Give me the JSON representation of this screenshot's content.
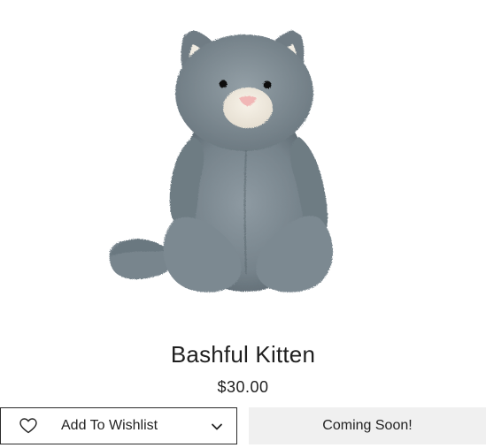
{
  "product": {
    "title": "Bashful Kitten",
    "price": "$30.00"
  },
  "actions": {
    "wishlist_label": "Add To Wishlist",
    "coming_soon_label": "Coming Soon!"
  },
  "icons": {
    "wishlist": "heart-icon",
    "dropdown": "chevron-down-icon"
  },
  "colors": {
    "plush_gray": "#7e8b93",
    "button_border": "#2a2a2a",
    "disabled_bg": "#f0f0f0"
  }
}
